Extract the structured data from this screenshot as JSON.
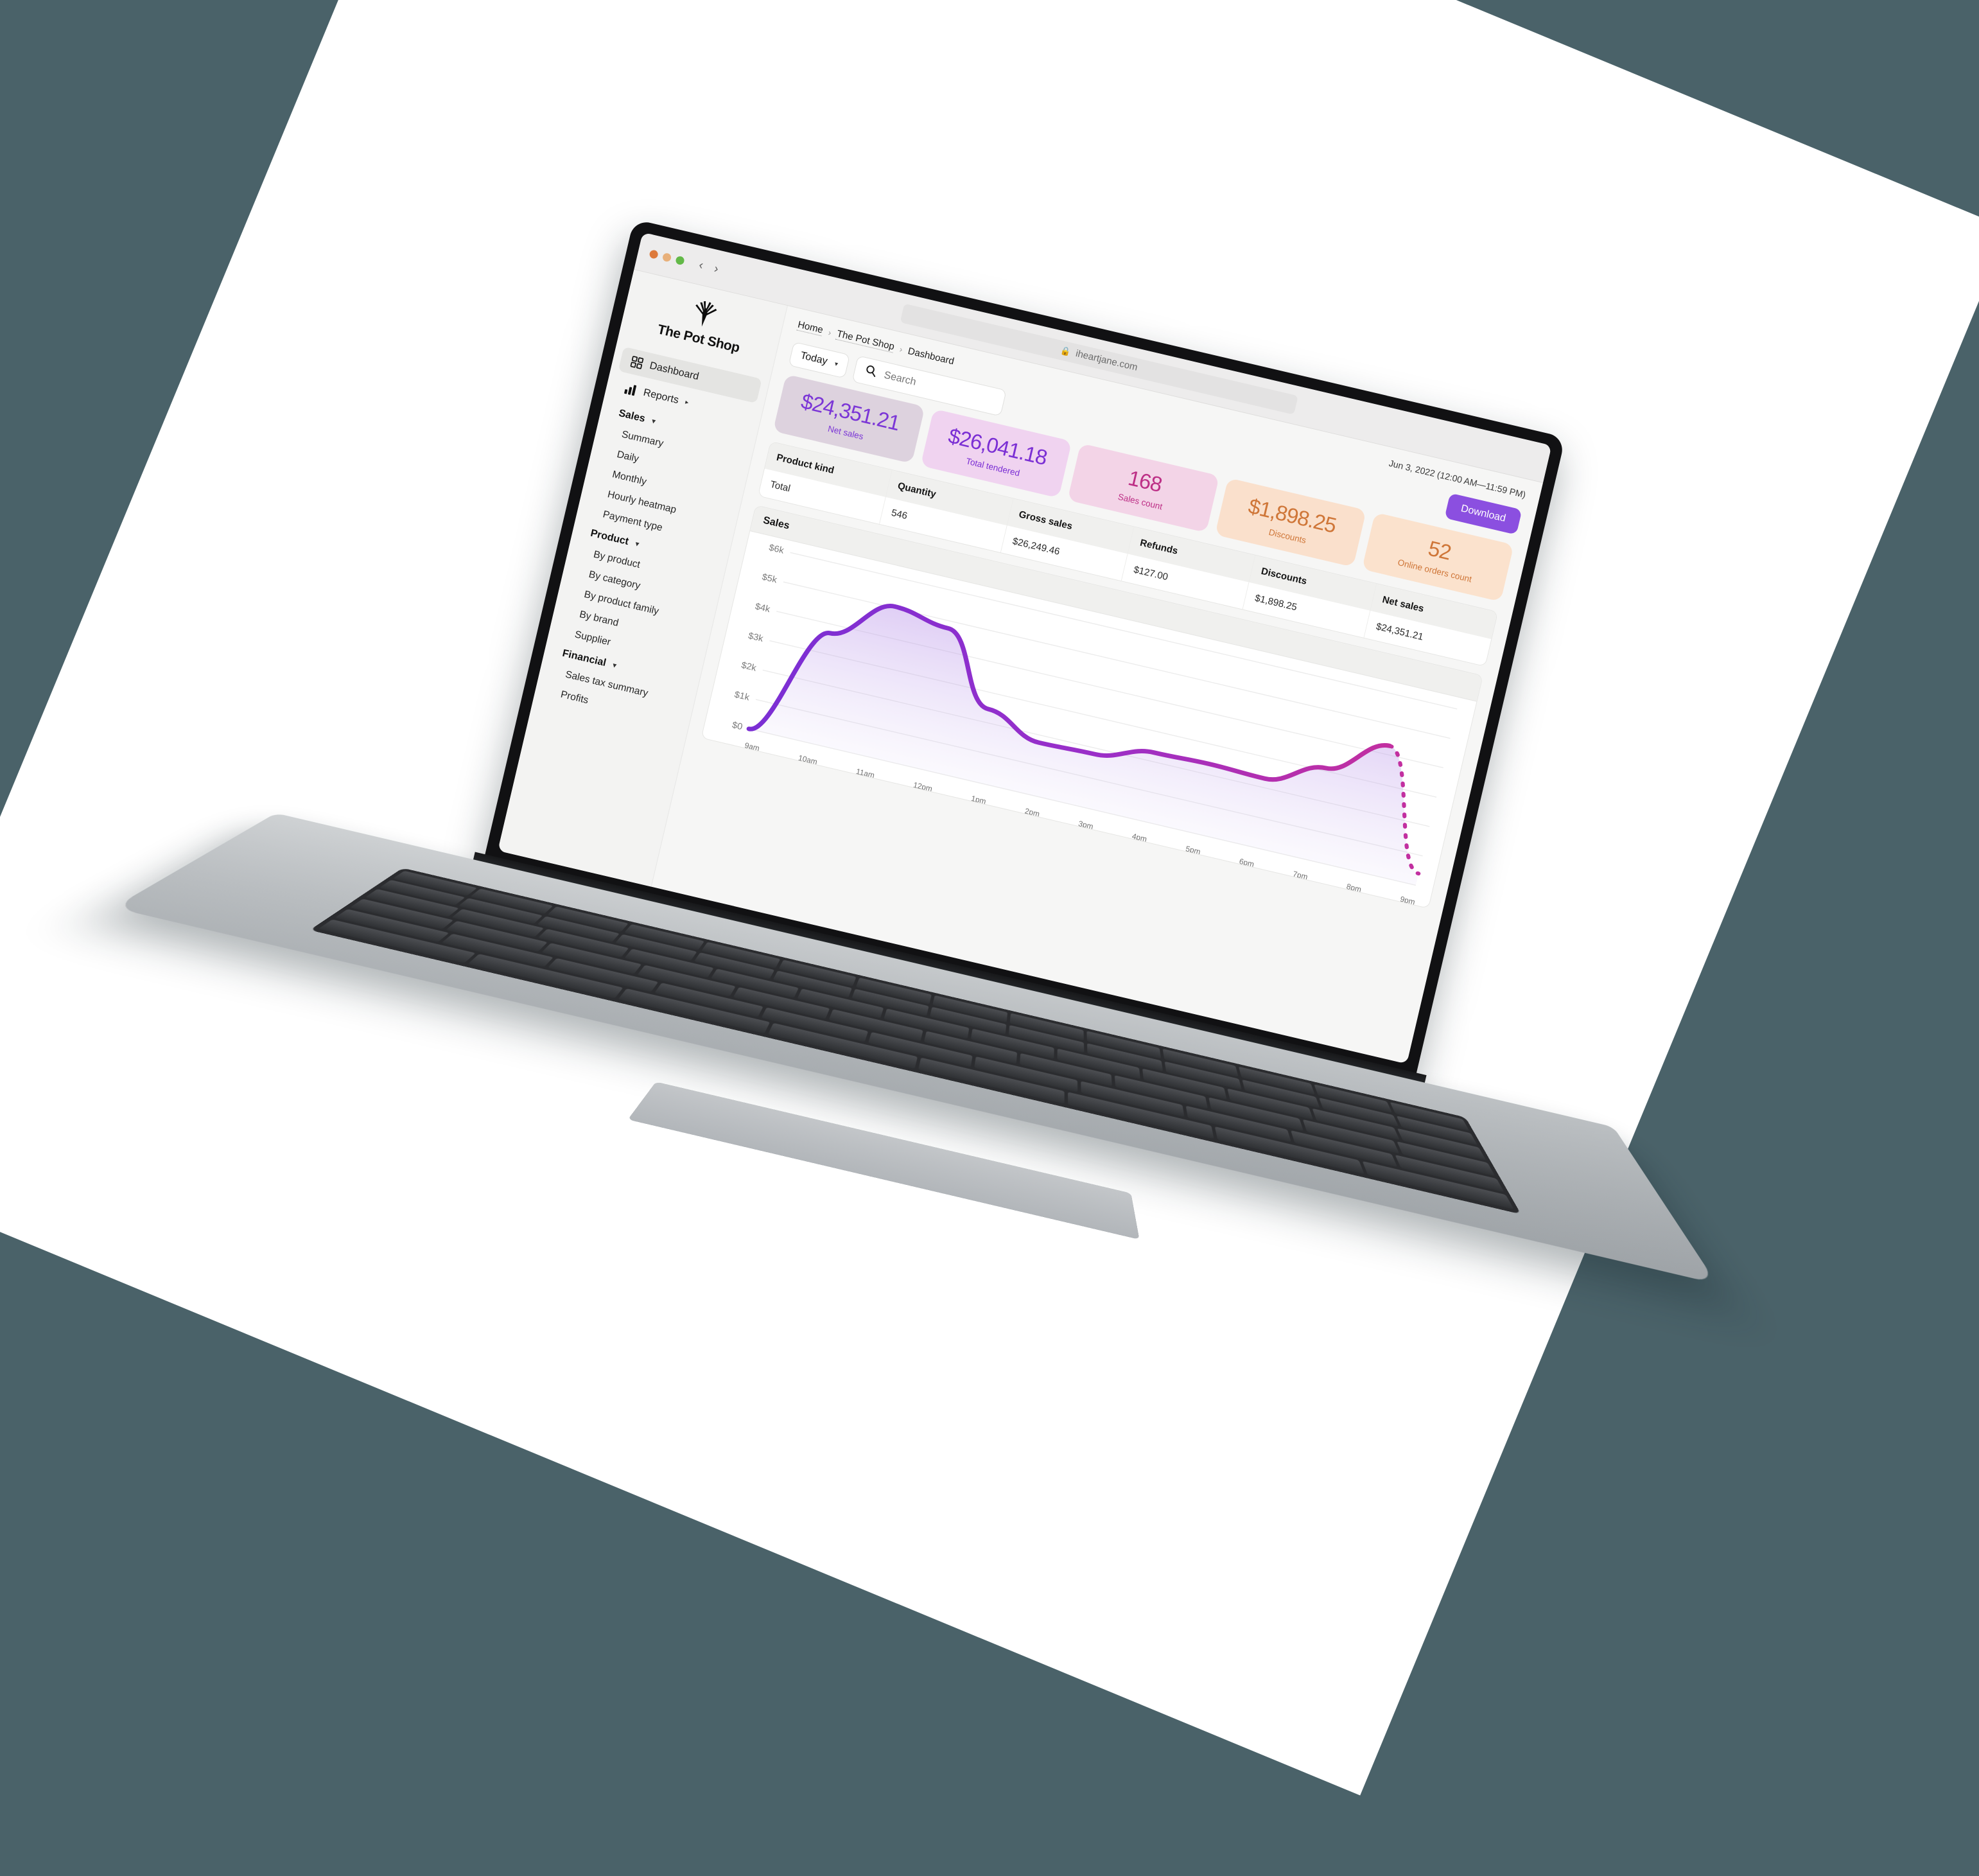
{
  "browser": {
    "url": "iheartjane.com",
    "lock_icon": "lock-icon",
    "back_icon": "chevron-left-icon",
    "forward_icon": "chevron-right-icon",
    "traffic_lights": [
      "close-red",
      "minimize-amber",
      "maximize-green"
    ]
  },
  "sidebar": {
    "logo_text": "The Pot Shop",
    "logo_icon": "cannabis-leaf-icon",
    "primary": [
      {
        "label": "Dashboard",
        "icon": "grid-squares-icon",
        "active": true
      },
      {
        "label": "Reports",
        "icon": "bar-chart-icon",
        "active": false,
        "chevron": "chevron-right-icon"
      }
    ],
    "groups": [
      {
        "label": "Sales",
        "caret": "caret-down-icon",
        "items": [
          "Summary",
          "Daily",
          "Monthly",
          "Hourly heatmap",
          "Payment type"
        ]
      },
      {
        "label": "Product",
        "caret": "caret-down-icon",
        "items": [
          "By product",
          "By category",
          "By product family",
          "By brand",
          "Supplier"
        ]
      },
      {
        "label": "Financial",
        "caret": "caret-down-icon",
        "items": [
          "Sales tax summary",
          "Profits"
        ]
      }
    ]
  },
  "header": {
    "breadcrumbs": [
      "Home",
      "The Pot Shop",
      "Dashboard"
    ],
    "separator": "›",
    "date_range": "Jun 3, 2022 (12:00 AM—11:59 PM)",
    "period_select": "Today",
    "period_caret": "chevron-down-icon",
    "search_placeholder": "Search",
    "search_value": "",
    "search_icon": "search-icon",
    "download_label": "Download",
    "download_color": "#8b4fe0"
  },
  "stats": [
    {
      "value": "$24,351.21",
      "label": "Net sales",
      "bg": "#ddd2de",
      "fg": "#7b36d6"
    },
    {
      "value": "$26,041.18",
      "label": "Total tendered",
      "bg": "#f0d3f0",
      "fg": "#7b2fd4"
    },
    {
      "value": "168",
      "label": "Sales count",
      "bg": "#f3d4e7",
      "fg": "#bd2f86"
    },
    {
      "value": "$1,898.25",
      "label": "Discounts",
      "bg": "#fae0cc",
      "fg": "#cf7638"
    },
    {
      "value": "52",
      "label": "Online orders count",
      "bg": "#fbe2cd",
      "fg": "#cf7638"
    }
  ],
  "table": {
    "columns": [
      "Product kind",
      "Quantity",
      "Gross sales",
      "Refunds",
      "Discounts",
      "Net sales"
    ],
    "rows": [
      [
        "Total",
        "546",
        "$26,249.46",
        "$127.00",
        "$1,898.25",
        "$24,351.21"
      ]
    ]
  },
  "chart_panel_title": "Sales",
  "chart_data": {
    "type": "area",
    "title": "Sales",
    "xlabel": "",
    "ylabel": "",
    "ylim": [
      0,
      6000
    ],
    "ytick_labels": [
      "$0",
      "$1k",
      "$2k",
      "$3k",
      "$4k",
      "$5k",
      "$6k"
    ],
    "ytick_values": [
      0,
      1000,
      2000,
      3000,
      4000,
      5000,
      6000
    ],
    "grid": true,
    "legend": "none",
    "line_color": "#8b2fd4",
    "line_color_end": "#c22fa0",
    "projection_style": "dashed",
    "x": [
      "9am",
      "10am",
      "11am",
      "12pm",
      "1pm",
      "2pm",
      "3pm",
      "4pm",
      "5pm",
      "6pm",
      "7pm",
      "8pm",
      "9pm"
    ],
    "values": [
      0,
      3700,
      5050,
      4750,
      2450,
      1750,
      1800,
      2300,
      2350,
      2300,
      3100,
      4300,
      400
    ],
    "solid_until": "8pm",
    "projected_from": "8pm"
  }
}
